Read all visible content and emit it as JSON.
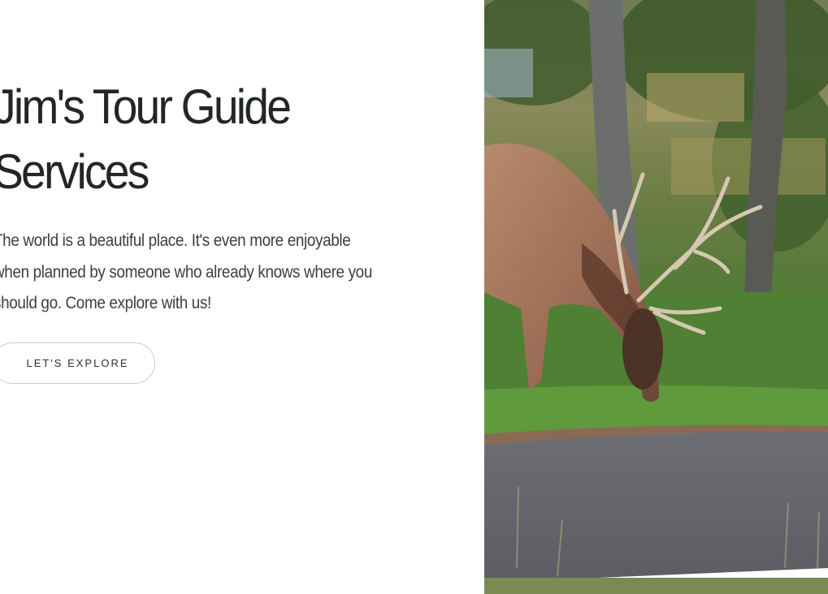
{
  "hero": {
    "title": "Jim's Tour Guide Services",
    "description": "The world is a beautiful place. It's even more enjoyable when planned by someone who already knows where you should go. Come explore with us!",
    "cta_label": "LET'S EXPLORE"
  },
  "colors": {
    "background": "#ffffff",
    "title_text": "#222629",
    "body_text": "#3a3f44",
    "button_border": "#c9cdd1"
  },
  "image": {
    "subject": "elk grazing beside a road"
  }
}
